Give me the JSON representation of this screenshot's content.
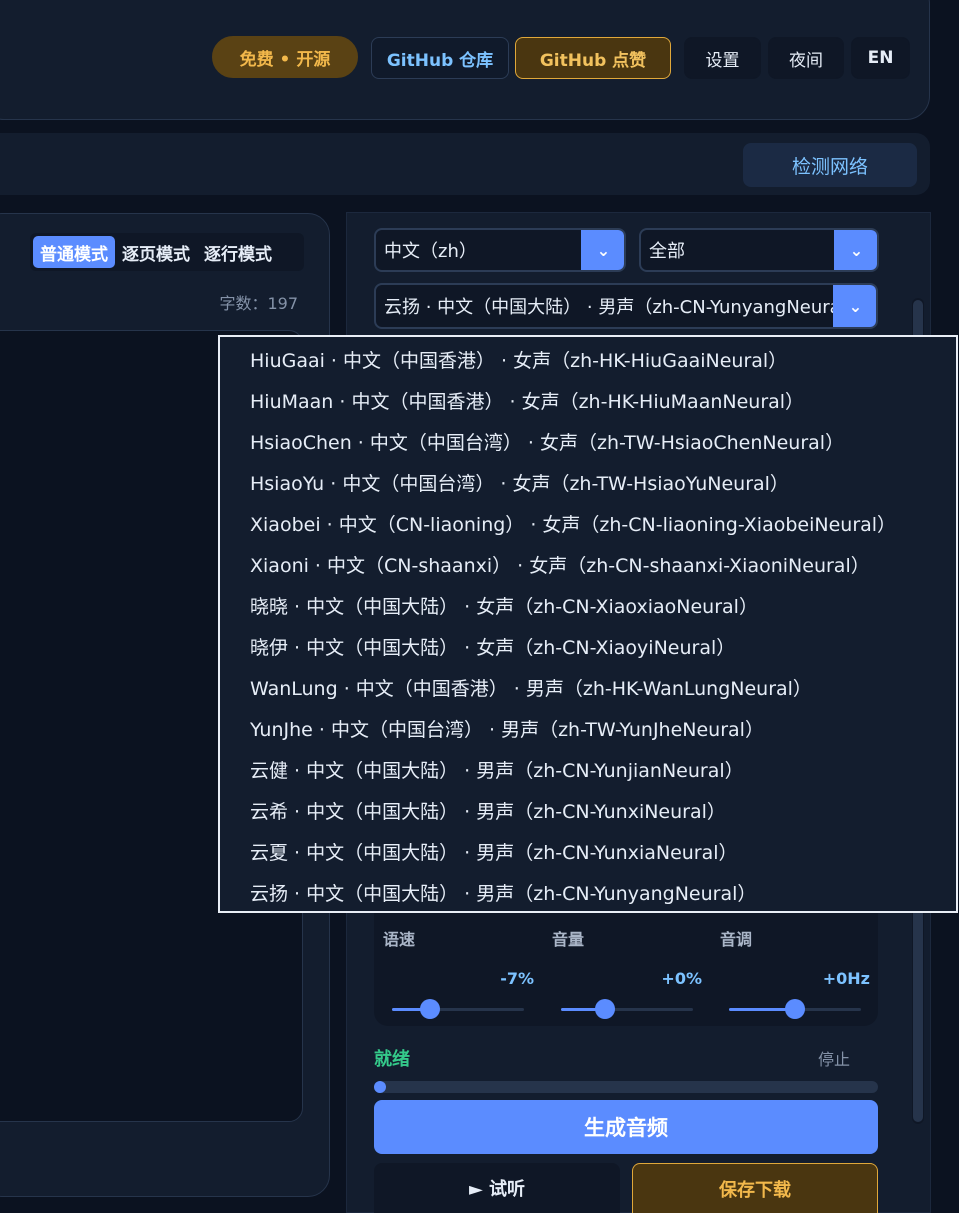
{
  "header": {
    "badge_free": "免费 • 开源",
    "github_repo": "GitHub 仓库",
    "github_star": "GitHub 点赞",
    "settings": "设置",
    "night": "夜间",
    "lang": "EN"
  },
  "toolbar": {
    "detect_network": "检测网络"
  },
  "editor": {
    "modes": [
      "普通模式",
      "逐页模式",
      "逐行模式"
    ],
    "active_mode": "普通模式",
    "word_count": "字数：197"
  },
  "voice_settings": {
    "language_select": "中文（zh）",
    "gender_select": "全部",
    "voice_select": "云扬 · 中文（中国大陆） · 男声（zh-CN-YunyangNeural）",
    "voice_options": [
      "HiuGaai · 中文（中国香港） · 女声（zh-HK-HiuGaaiNeural）",
      "HiuMaan · 中文（中国香港） · 女声（zh-HK-HiuMaanNeural）",
      "HsiaoChen · 中文（中国台湾） · 女声（zh-TW-HsiaoChenNeural）",
      "HsiaoYu · 中文（中国台湾） · 女声（zh-TW-HsiaoYuNeural）",
      "Xiaobei · 中文（CN-liaoning） · 女声（zh-CN-liaoning-XiaobeiNeural）",
      "Xiaoni · 中文（CN-shaanxi） · 女声（zh-CN-shaanxi-XiaoniNeural）",
      "晓晓 · 中文（中国大陆） · 女声（zh-CN-XiaoxiaoNeural）",
      "晓伊 · 中文（中国大陆） · 女声（zh-CN-XiaoyiNeural）",
      "WanLung · 中文（中国香港） · 男声（zh-HK-WanLungNeural）",
      "YunJhe · 中文（中国台湾） · 男声（zh-TW-YunJheNeural）",
      "云健 · 中文（中国大陆） · 男声（zh-CN-YunjianNeural）",
      "云希 · 中文（中国大陆） · 男声（zh-CN-YunxiNeural）",
      "云夏 · 中文（中国大陆） · 男声（zh-CN-YunxiaNeural）",
      "云扬 · 中文（中国大陆） · 男声（zh-CN-YunyangNeural）"
    ]
  },
  "sliders": {
    "rate": {
      "label": "语速",
      "value": "-7%",
      "position": 0.29
    },
    "volume": {
      "label": "音量",
      "value": "+0%",
      "position": 0.33
    },
    "pitch": {
      "label": "音调",
      "value": "+0Hz",
      "position": 0.5
    }
  },
  "status": {
    "text": "就绪",
    "stop": "停止",
    "progress": 0.02
  },
  "actions": {
    "generate": "生成音频",
    "listen": "► 试听",
    "save": "保存下载"
  },
  "colors": {
    "accent": "#5b8cff",
    "gold": "#f2b84b",
    "ready": "#34c98a",
    "link": "#7cc2ff"
  }
}
